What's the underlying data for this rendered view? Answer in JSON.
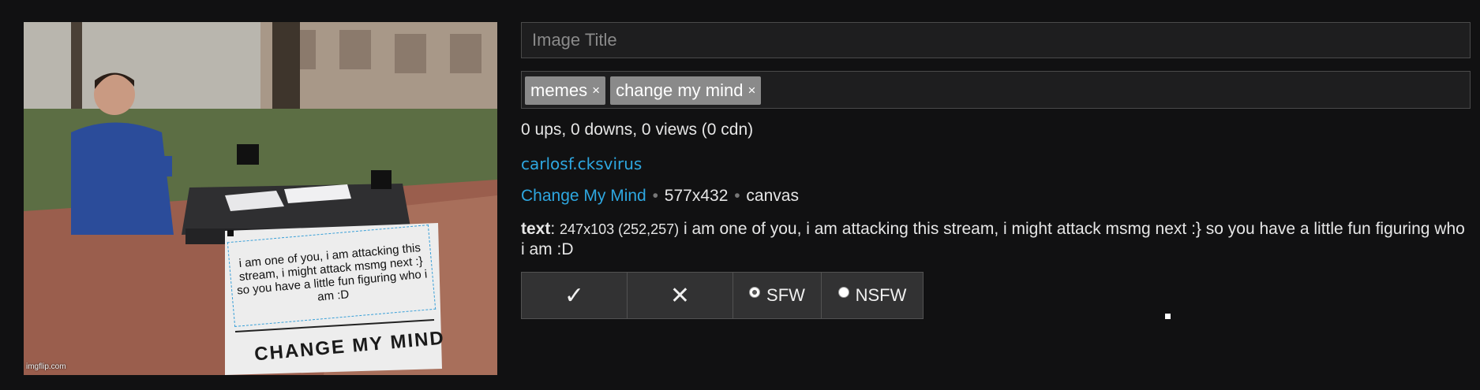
{
  "meme": {
    "caption": "i am one of you, i am attacking this stream, i might attack msmg next :} so you have a little fun figuring who i am :D",
    "sign_text": "CHANGE MY MIND",
    "watermark": "imgflip.com"
  },
  "form": {
    "title_placeholder": "Image Title",
    "tags": [
      {
        "label": "memes",
        "remove": "×"
      },
      {
        "label": "change my mind",
        "remove": "×"
      }
    ]
  },
  "stats": "0 ups, 0 downs, 0 views (0 cdn)",
  "user": "carlosf.cksvirus",
  "meta": {
    "template": "Change My Mind",
    "separator": "•",
    "size": "577x432",
    "type": "canvas"
  },
  "text_box": {
    "label": "text",
    "dims": "247x103 (252,257)",
    "content": "i am one of you, i am attacking this stream, i might attack msmg next :} so you have a little fun figuring who i am :D"
  },
  "buttons": {
    "approve": "✓",
    "reject": "✕",
    "sfw": "SFW",
    "nsfw": "NSFW"
  }
}
